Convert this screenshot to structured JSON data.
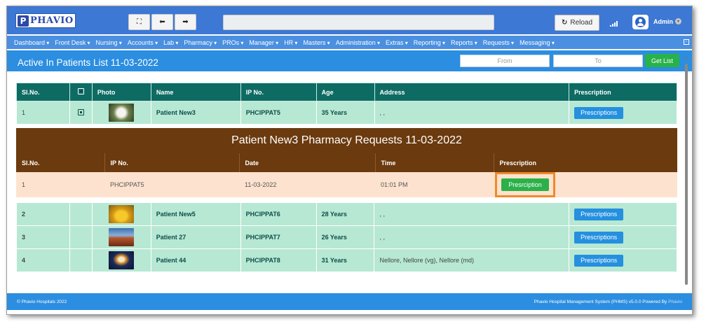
{
  "app": {
    "logo_text": "PHAVIO",
    "logo_mark": "P"
  },
  "toolbar": {
    "fullscreen_icon": "⛶",
    "back_icon": "⬅",
    "forward_icon": "➡",
    "reload_label": "Reload",
    "reload_icon": "↻",
    "user_label": "Admin",
    "user_caret": "▾"
  },
  "menu": [
    "Dashboard",
    "Front Desk",
    "Nursing",
    "Accounts",
    "Lab",
    "Pharmacy",
    "PROs",
    "Manager",
    "HR",
    "Masters",
    "Administration",
    "Extras",
    "Reporting",
    "Reports",
    "Requests",
    "Messaging"
  ],
  "page": {
    "title": "Active In Patients List 11-03-2022",
    "from_placeholder": "From",
    "to_placeholder": "To",
    "get_list_label": "Get List"
  },
  "main_table": {
    "headers": [
      "Sl.No.",
      "",
      "Photo",
      "Name",
      "IP No.",
      "Age",
      "Address",
      "Prescription"
    ],
    "button_label": "Prescriptions",
    "rows": [
      {
        "sl": "1",
        "name": "Patient New3",
        "ip": "PHCIPPAT5",
        "age": "35 Years",
        "address": ", ,"
      },
      {
        "sl": "2",
        "name": "Patient New5",
        "ip": "PHCIPPAT6",
        "age": "28 Years",
        "address": ", ,"
      },
      {
        "sl": "3",
        "name": "Patient 27",
        "ip": "PHCIPPAT7",
        "age": "26 Years",
        "address": ", ,"
      },
      {
        "sl": "4",
        "name": "Patient 44",
        "ip": "PHCIPPAT8",
        "age": "31 Years",
        "address": "Nellore, Nellore (vg), Nellore (md)"
      }
    ]
  },
  "sub_table": {
    "title": "Patient New3 Pharmacy Requests 11-03-2022",
    "headers": [
      "Sl.No.",
      "IP No.",
      "Date",
      "Time",
      "Prescription"
    ],
    "row": {
      "sl": "1",
      "ip": "PHCIPPAT5",
      "date": "11-03-2022",
      "time": "01:01 PM",
      "button_label": "Presrciption"
    }
  },
  "footer": {
    "left": "© Phavio Hospitals 2022",
    "right_text": "Phavio Hospital Management System (PHMS) v5.0.0 Powered By ",
    "right_brand": "Phavio"
  },
  "colors": {
    "topbar": "#3c78d4",
    "menubar": "#4a8fe0",
    "titlebar": "#2b8ee0",
    "table_header": "#0e6b64",
    "table_row": "#b7e8d3",
    "sub_header": "#6b3a0e",
    "sub_row": "#fde3cf",
    "highlight": "#f08a2a",
    "green_button": "#2cb14a"
  }
}
